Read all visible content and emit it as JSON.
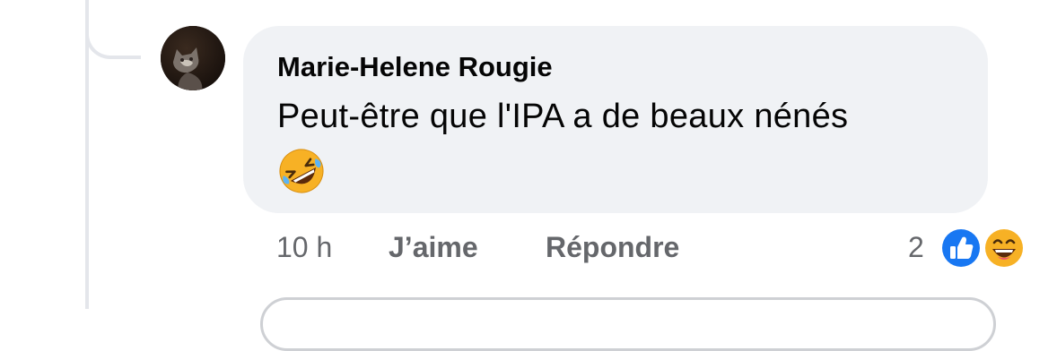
{
  "comment": {
    "author": "Marie-Helene Rougie",
    "text": "Peut-être que l'IPA a de beaux nénés",
    "emoji": "rolling-on-floor-laughing",
    "time": "10 h",
    "like_label": "J’aime",
    "reply_label": "Répondre",
    "reaction_count": "2",
    "reactions": [
      "like",
      "haha"
    ]
  },
  "colors": {
    "bubble": "#f0f2f5",
    "meta_text": "#65676b",
    "like_blue": "#1877f2",
    "emoji_yellow": "#f7b125"
  }
}
